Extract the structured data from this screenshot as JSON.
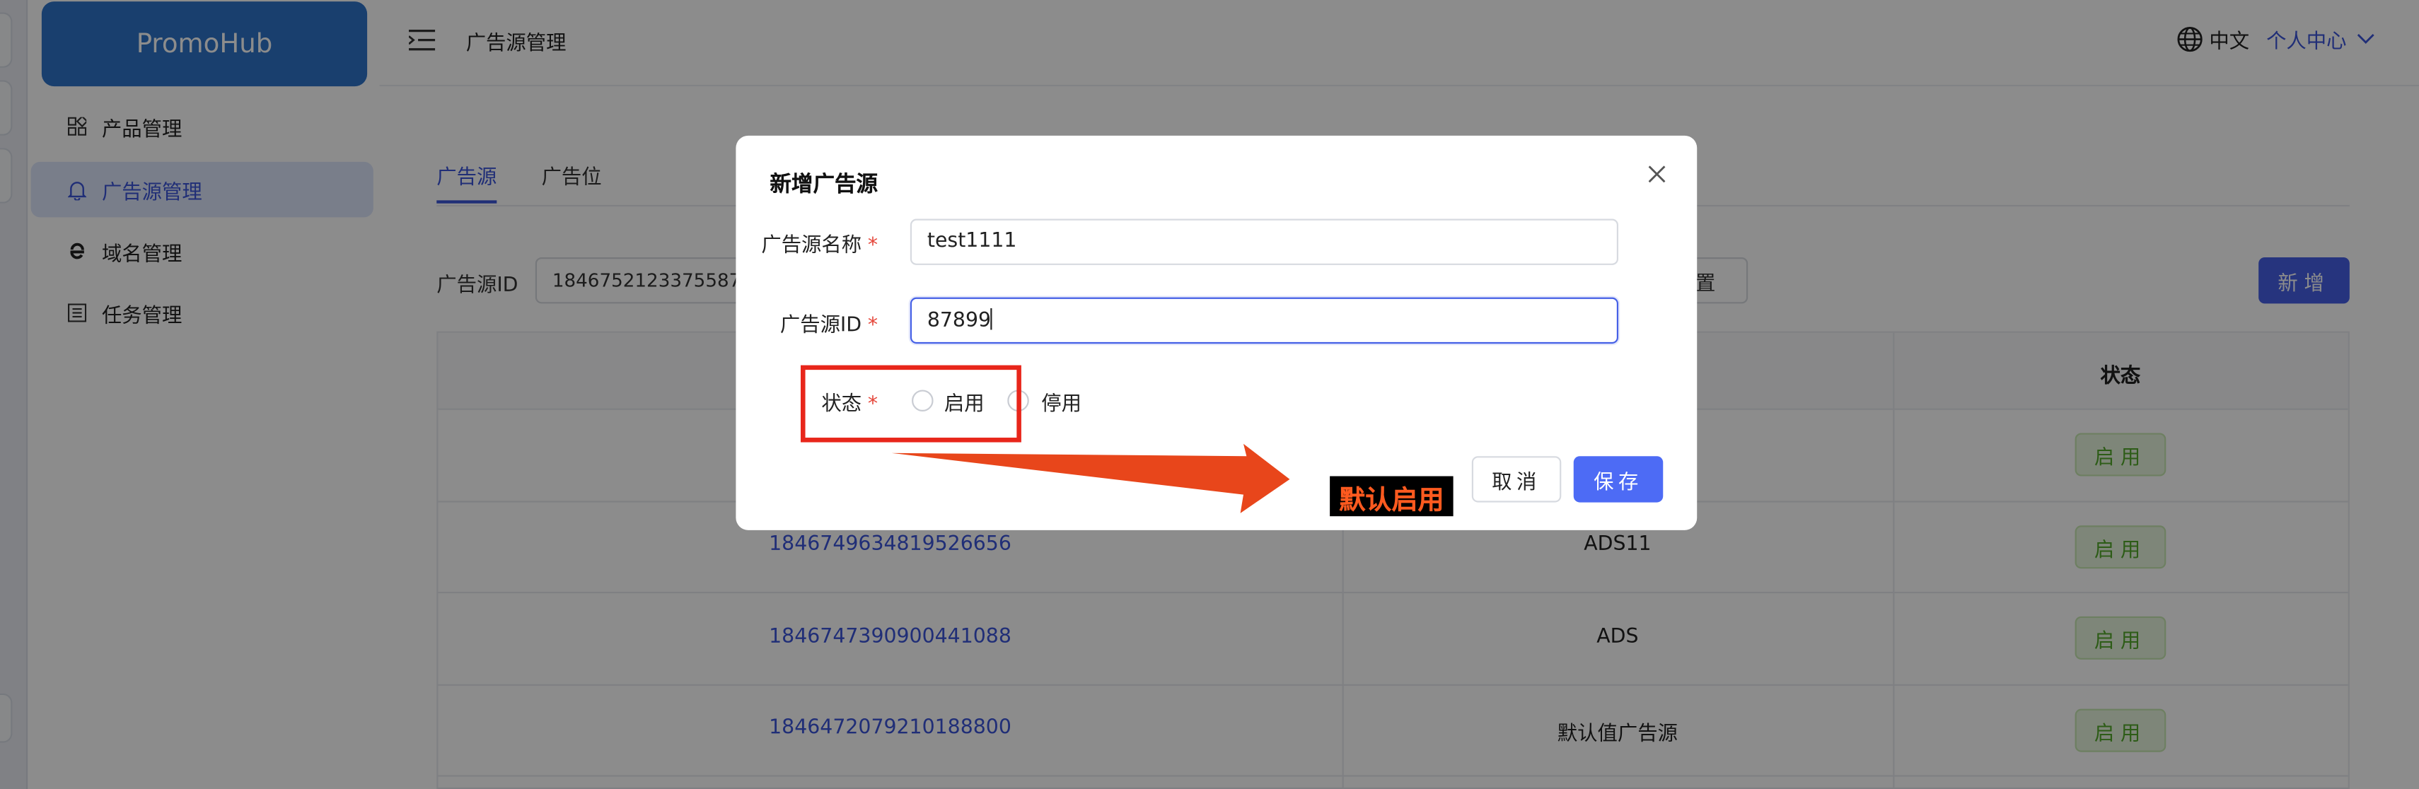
{
  "app": {
    "logo": "PromoHub"
  },
  "sidebar": {
    "items": [
      {
        "label": "产品管理",
        "icon": "grid-icon"
      },
      {
        "label": "广告源管理",
        "icon": "bell-icon",
        "active": true
      },
      {
        "label": "域名管理",
        "icon": "browser-e-icon"
      },
      {
        "label": "任务管理",
        "icon": "list-icon"
      }
    ]
  },
  "header": {
    "breadcrumb": "广告源管理",
    "language": "中文",
    "user_menu": "个人中心"
  },
  "page": {
    "tabs": [
      "广告源",
      "广告位"
    ],
    "active_tab": 0,
    "filter_label": "广告源ID",
    "filter_value": "1846752123375587",
    "reset_label": "置",
    "add_label": "新增"
  },
  "table": {
    "status_header": "状态",
    "rows": [
      {
        "id": "",
        "name": "",
        "status": "启用"
      },
      {
        "id": "1846749634819526656",
        "name": "ADS11",
        "status": "启用"
      },
      {
        "id": "1846747390900441088",
        "name": "ADS",
        "status": "启用"
      },
      {
        "id": "1846472079210188800",
        "name": "默认值广告源",
        "status": "启用"
      }
    ]
  },
  "modal": {
    "title": "新增广告源",
    "fields": {
      "name_label": "广告源名称",
      "name_value": "test1111",
      "id_label": "广告源ID",
      "id_value": "87899",
      "status_label": "状态",
      "status_options": [
        "启用",
        "停用"
      ]
    },
    "required_mark": "*",
    "cancel_label": "取消",
    "save_label": "保存"
  },
  "annotation": {
    "text": "默认启用"
  },
  "colors": {
    "primary": "#4560e6",
    "annotation_red": "#e8261b",
    "tag_green": "#52a82a"
  }
}
